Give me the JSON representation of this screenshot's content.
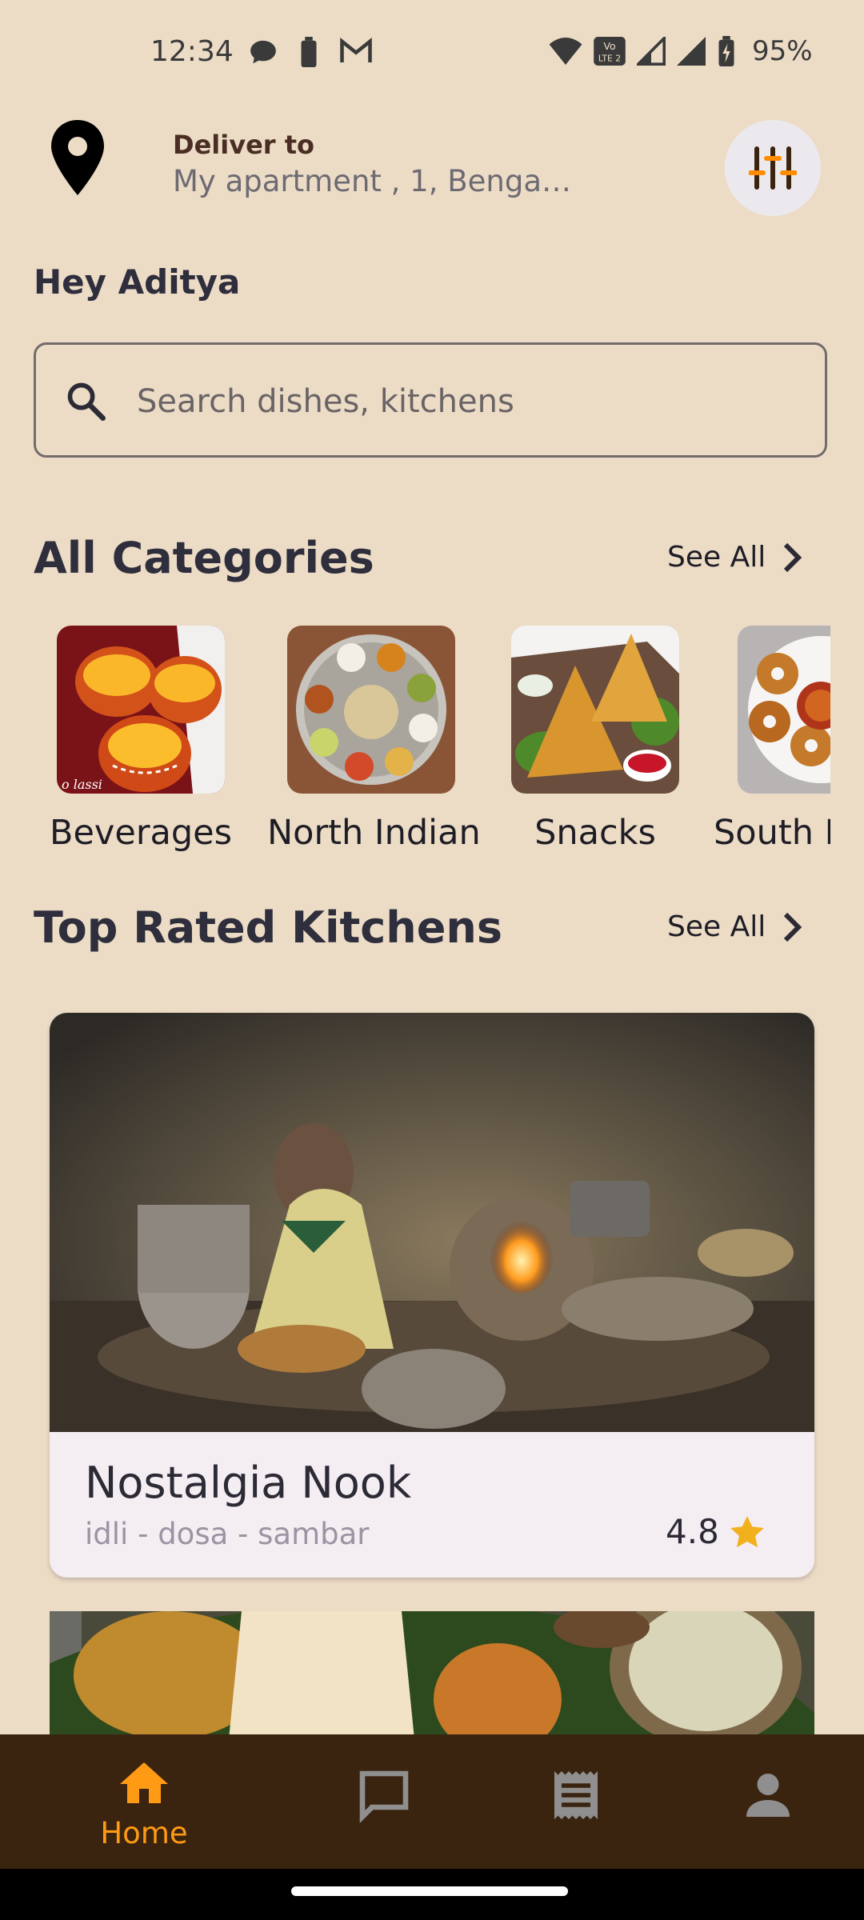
{
  "status_bar": {
    "time": "12:34",
    "battery_text": "95%",
    "left_icons": [
      "chat-bubble-icon",
      "battery-icon",
      "gmail-icon"
    ],
    "right_icons": [
      "wifi-icon",
      "volte-icon",
      "signal-icon",
      "signal-icon",
      "battery-charging-icon"
    ]
  },
  "header": {
    "deliver_label": "Deliver to",
    "address": "My apartment , 1, Bengal...",
    "icons": [
      "location-pin-icon",
      "filter-sliders-icon"
    ]
  },
  "greeting": "Hey Aditya",
  "search": {
    "placeholder": "Search dishes, kitchens",
    "value": ""
  },
  "categories_section": {
    "title": "All Categories",
    "see_all": "See All",
    "items": [
      {
        "label": "Beverages",
        "image_text": "o lassi"
      },
      {
        "label": "North Indian"
      },
      {
        "label": "Snacks"
      },
      {
        "label": "South I"
      }
    ]
  },
  "kitchens_section": {
    "title": "Top Rated Kitchens",
    "see_all": "See All",
    "items": [
      {
        "name": "Nostalgia Nook",
        "cuisine": "idli - dosa - sambar",
        "rating": "4.8"
      }
    ]
  },
  "bottom_nav": {
    "items": [
      {
        "label": "Home",
        "icon": "home-icon",
        "active": true
      },
      {
        "label": "",
        "icon": "chat-icon",
        "active": false
      },
      {
        "label": "",
        "icon": "receipt-icon",
        "active": false
      },
      {
        "label": "",
        "icon": "profile-icon",
        "active": false
      }
    ]
  },
  "colors": {
    "background": "#ecdcc6",
    "accent": "#ff9a15",
    "nav_bg": "#3a2410",
    "card_bg": "#f4eef3",
    "star": "#f2b01e"
  }
}
